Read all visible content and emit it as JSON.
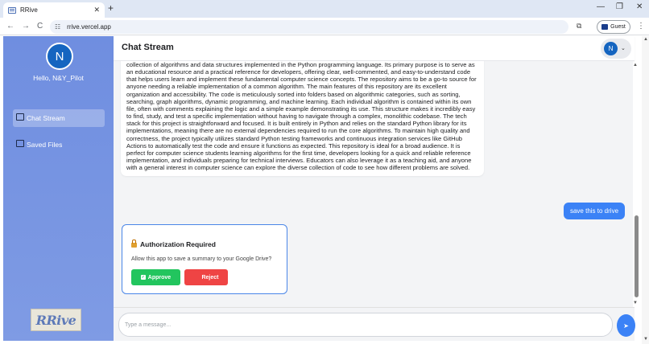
{
  "browser": {
    "tab_title": "RRive",
    "tab_close": "✕",
    "new_tab": "+",
    "url": "rrive.vercel.app",
    "guest_label": "Guest",
    "nav_back": "←",
    "nav_forward": "→",
    "nav_reload": "C",
    "win_minimize": "—",
    "win_restore": "❐",
    "win_close": "✕"
  },
  "sidebar": {
    "avatar_initial": "N",
    "greeting": "Hello, N&Y_Pilot",
    "items": [
      {
        "label": "Chat Stream",
        "active": true
      },
      {
        "label": "Saved Files",
        "active": false
      }
    ],
    "logo_text": "RRive"
  },
  "header": {
    "title": "Chat Stream",
    "avatar_initial": "N",
    "chevron": "⌄"
  },
  "messages": {
    "bot_text": "collection of algorithms and data structures implemented in the Python programming language. Its primary purpose is to serve as an educational resource and a practical reference for developers, offering clear, well-commented, and easy-to-understand code that helps users learn and implement these fundamental computer science concepts. The repository aims to be a go-to source for anyone needing a reliable implementation of a common algorithm. The main features of this repository are its excellent organization and accessibility. The code is meticulously sorted into folders based on algorithmic categories, such as sorting, searching, graph algorithms, dynamic programming, and machine learning. Each individual algorithm is contained within its own file, often with comments explaining the logic and a simple example demonstrating its use. This structure makes it incredibly easy to find, study, and test a specific implementation without having to navigate through a complex, monolithic codebase. The tech stack for this project is straightforward and focused. It is built entirely in Python and relies on the standard Python library for its implementations, meaning there are no external dependencies required to run the core algorithms. To maintain high quality and correctness, the project typically utilizes standard Python testing frameworks and continuous integration services like GitHub Actions to automatically test the code and ensure it functions as expected. This repository is ideal for a broad audience. It is perfect for computer science students learning algorithms for the first time, developers looking for a quick and reliable reference implementation, and individuals preparing for technical interviews. Educators can also leverage it as a teaching aid, and anyone with a general interest in computer science can explore the diverse collection of code to see how different problems are solved.",
    "user_text": "save this to drive"
  },
  "auth_card": {
    "title": "Authorization Required",
    "body": "Allow this app to save a summary to your Google Drive?",
    "approve_label": "Approve",
    "reject_label": "Reject",
    "approve_color": "#22c55e",
    "reject_color": "#ef4444"
  },
  "composer": {
    "placeholder": "Type a message...",
    "send_icon": "➤"
  },
  "colors": {
    "sidebar": "#7b97e3",
    "accent": "#3b82f6",
    "avatar": "#1565c0"
  }
}
